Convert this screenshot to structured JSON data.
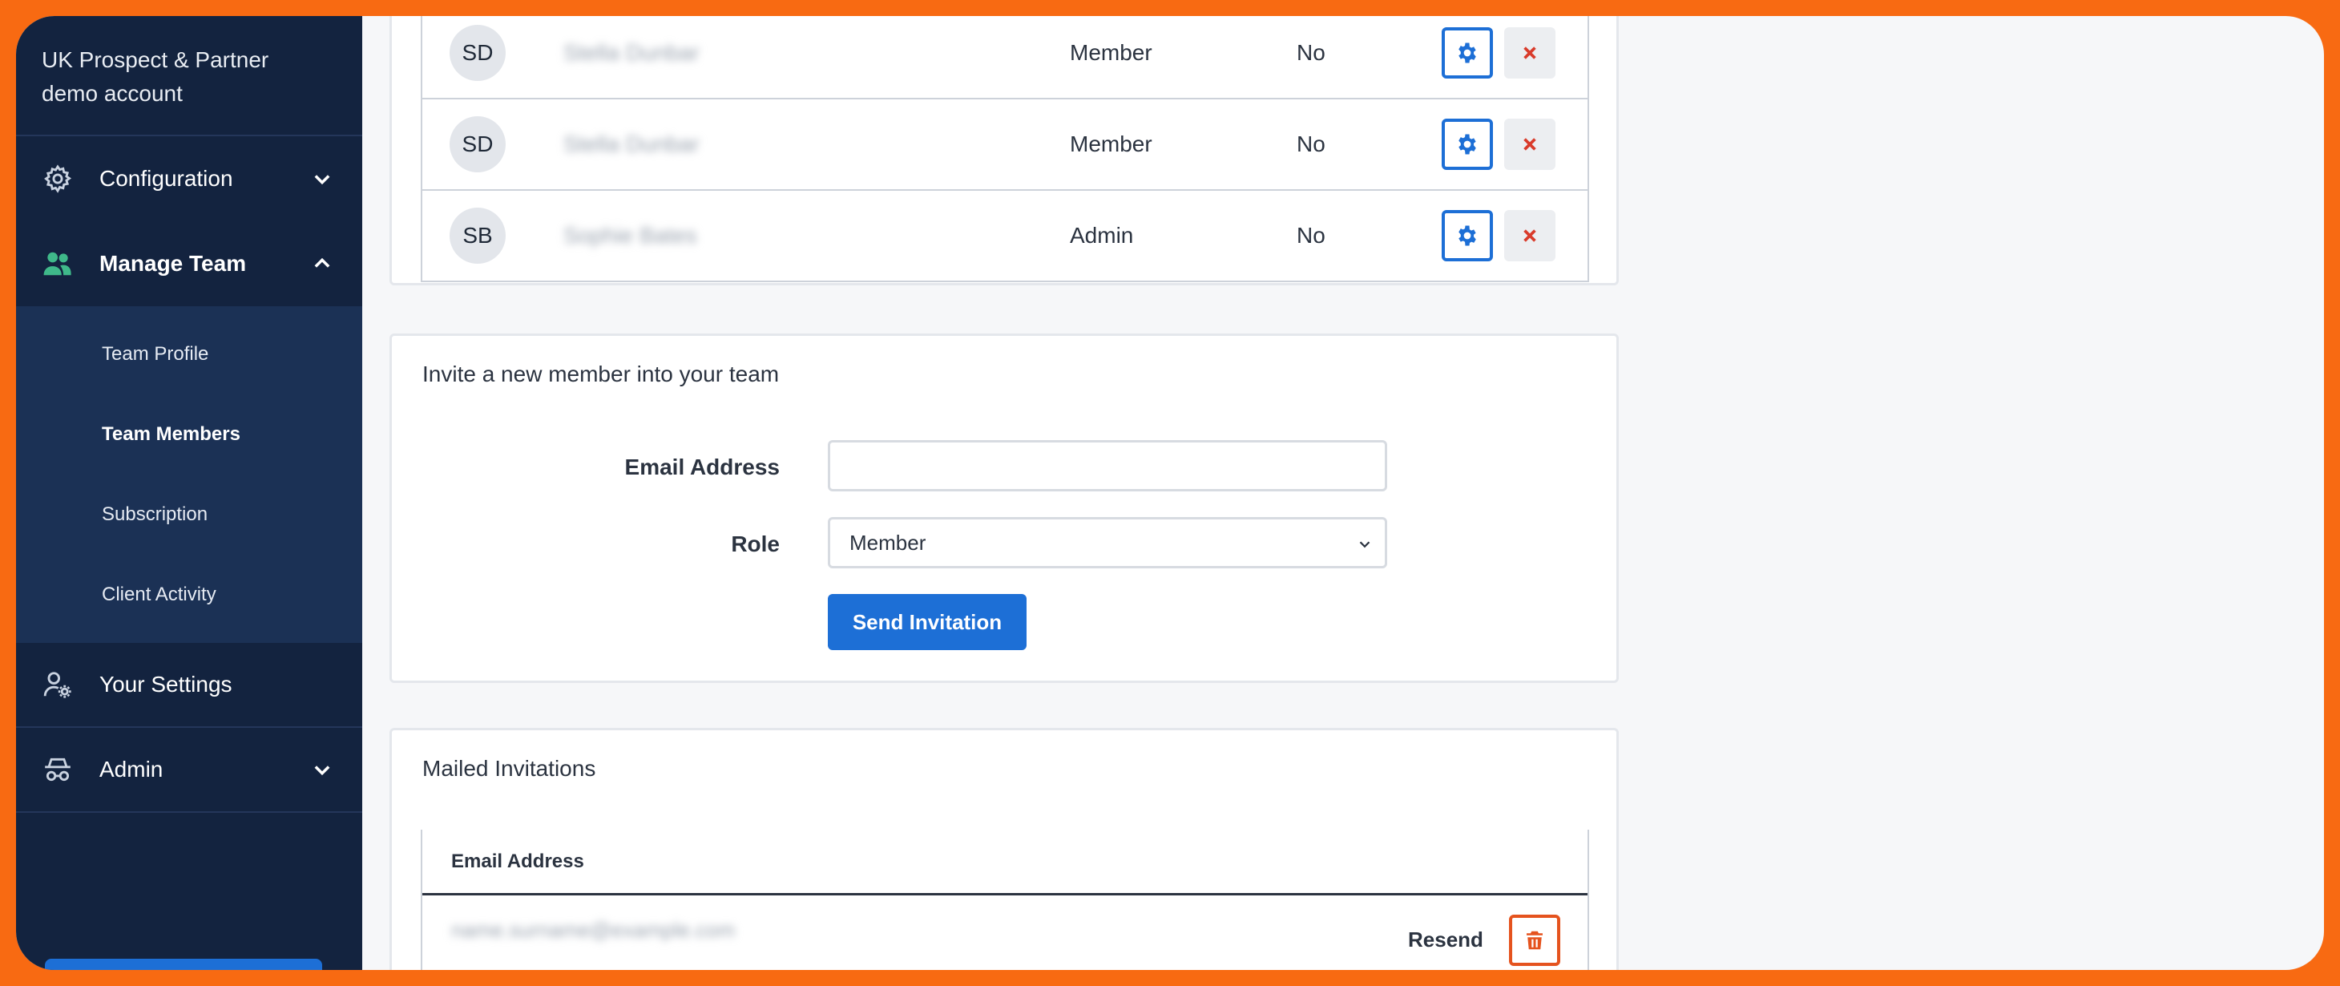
{
  "brand": {
    "line1": "UK Prospect & Partner",
    "line2": "demo account"
  },
  "nav": {
    "configuration": "Configuration",
    "manage_team": "Manage Team",
    "team_profile": "Team Profile",
    "team_members": "Team Members",
    "subscription": "Subscription",
    "client_activity": "Client Activity",
    "your_settings": "Your Settings",
    "admin": "Admin"
  },
  "members": [
    {
      "initials": "SD",
      "name": "Stella Dunbar",
      "role": "Member",
      "flag": "No"
    },
    {
      "initials": "SD",
      "name": "Stella Dunbar",
      "role": "Member",
      "flag": "No"
    },
    {
      "initials": "SB",
      "name": "Sophie Bates",
      "role": "Admin",
      "flag": "No"
    }
  ],
  "invite": {
    "title": "Invite a new member into your team",
    "email_label": "Email Address",
    "email_value": "",
    "role_label": "Role",
    "role_value": "Member",
    "send_label": "Send Invitation"
  },
  "mailed": {
    "title": "Mailed Invitations",
    "col_email": "Email Address",
    "rows": [
      {
        "email": "name.surname@example.com",
        "resend_label": "Resend"
      }
    ]
  },
  "colors": {
    "sidebar": "#13233f",
    "accent": "#1d6fd6",
    "danger": "#e5531e",
    "frame": "#f86a12"
  }
}
